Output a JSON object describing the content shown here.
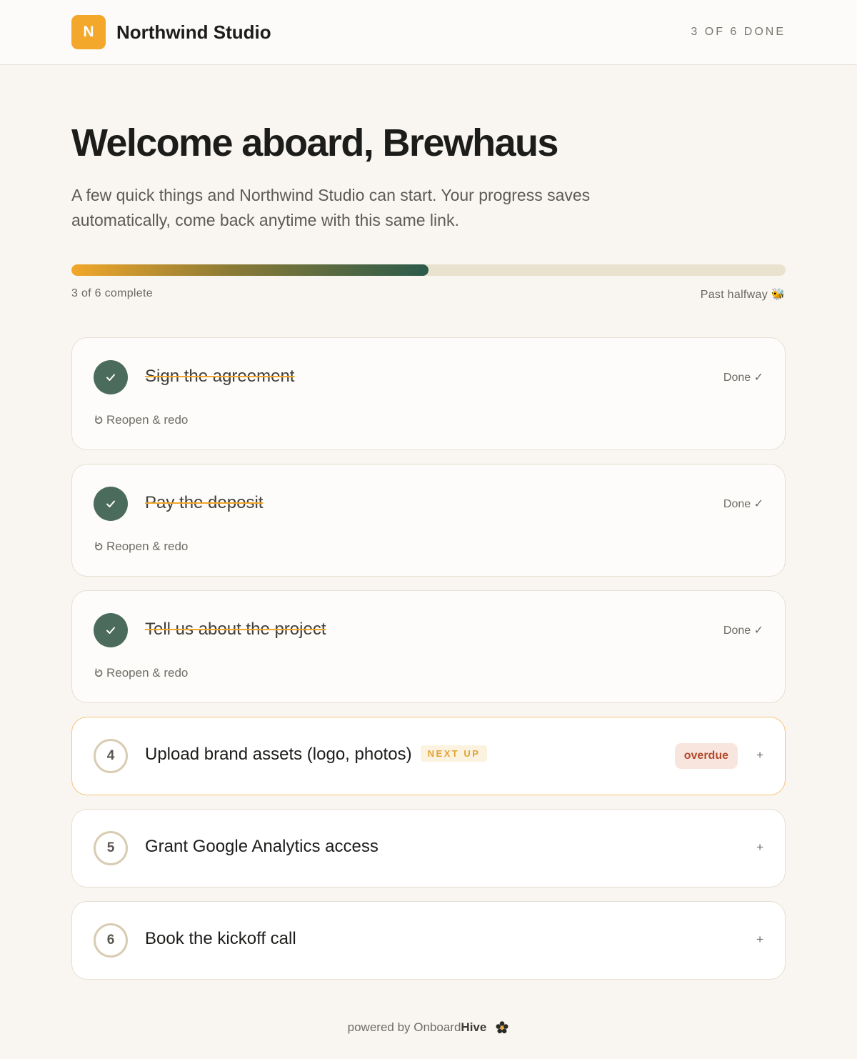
{
  "header": {
    "logo_letter": "N",
    "brand_name": "Northwind Studio",
    "count_label": "3 OF 6 DONE",
    "accent_color": "#f3a82b"
  },
  "main": {
    "title": "Welcome aboard, Brewhaus",
    "intro": "A few quick things and Northwind Studio can start. Your progress saves automatically, come back anytime with this same link.",
    "progress": {
      "completed": 3,
      "total": 6,
      "label": "3 of 6 complete",
      "note": "Past halfway 🐝"
    }
  },
  "tasks": {
    "done": [
      {
        "title": "Sign the agreement",
        "status": "Done ✓",
        "action": "Reopen & redo"
      },
      {
        "title": "Pay the deposit",
        "status": "Done ✓",
        "action": "Reopen & redo"
      },
      {
        "title": "Tell us about the project",
        "status": "Done ✓",
        "action": "Reopen & redo"
      }
    ],
    "open": [
      {
        "number": "4",
        "title": "Upload brand assets (logo, photos)",
        "badge": "NEXT UP",
        "flag": "overdue",
        "expand": "+"
      },
      {
        "number": "5",
        "title": "Grant Google Analytics access",
        "expand": "+"
      },
      {
        "number": "6",
        "title": "Book the kickoff call",
        "expand": "+"
      }
    ]
  },
  "footer": {
    "prefix": "powered by Onboard",
    "brand": "Hive"
  },
  "icons": {
    "check": "check-icon",
    "reopen": "reopen-arrow-icon",
    "footer_logo": "hive-logo-icon"
  }
}
